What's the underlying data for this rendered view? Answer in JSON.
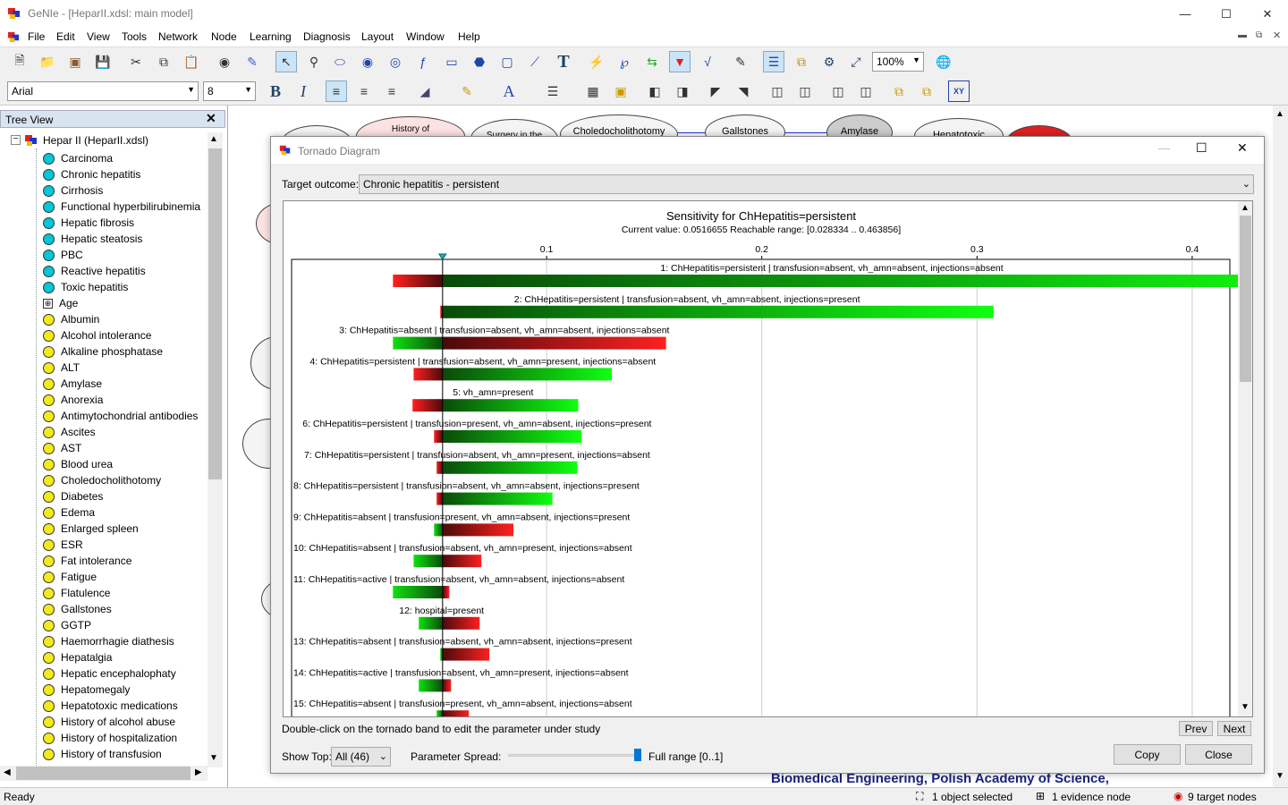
{
  "window": {
    "title": "GeNIe - [HeparII.xdsl: main model]"
  },
  "menu": [
    "File",
    "Edit",
    "View",
    "Tools",
    "Network",
    "Node",
    "Learning",
    "Diagnosis",
    "Layout",
    "Window",
    "Help"
  ],
  "toolbar": {
    "zoom": "100%",
    "font": "Arial",
    "font_size": "8"
  },
  "tree": {
    "header": "Tree View",
    "root": "Hepar II (HeparII.xdsl)",
    "items": [
      {
        "label": "Carcinoma",
        "kind": "target"
      },
      {
        "label": "Chronic hepatitis",
        "kind": "target"
      },
      {
        "label": "Cirrhosis",
        "kind": "target"
      },
      {
        "label": "Functional hyperbilirubinemia",
        "kind": "target"
      },
      {
        "label": "Hepatic fibrosis",
        "kind": "target"
      },
      {
        "label": "Hepatic steatosis",
        "kind": "target"
      },
      {
        "label": "PBC",
        "kind": "target"
      },
      {
        "label": "Reactive hepatitis",
        "kind": "target"
      },
      {
        "label": "Toxic hepatitis",
        "kind": "target"
      },
      {
        "label": "Age",
        "kind": "evidence"
      },
      {
        "label": "Albumin",
        "kind": "node"
      },
      {
        "label": "Alcohol intolerance",
        "kind": "node"
      },
      {
        "label": "Alkaline phosphatase",
        "kind": "node"
      },
      {
        "label": "ALT",
        "kind": "node"
      },
      {
        "label": "Amylase",
        "kind": "node"
      },
      {
        "label": "Anorexia",
        "kind": "node"
      },
      {
        "label": "Antimytochondrial antibodies",
        "kind": "node"
      },
      {
        "label": "Ascites",
        "kind": "node"
      },
      {
        "label": "AST",
        "kind": "node"
      },
      {
        "label": "Blood urea",
        "kind": "node"
      },
      {
        "label": "Choledocholithotomy",
        "kind": "node"
      },
      {
        "label": "Diabetes",
        "kind": "node"
      },
      {
        "label": "Edema",
        "kind": "node"
      },
      {
        "label": "Enlarged spleen",
        "kind": "node"
      },
      {
        "label": "ESR",
        "kind": "node"
      },
      {
        "label": "Fat intolerance",
        "kind": "node"
      },
      {
        "label": "Fatigue",
        "kind": "node"
      },
      {
        "label": "Flatulence",
        "kind": "node"
      },
      {
        "label": "Gallstones",
        "kind": "node"
      },
      {
        "label": "GGTP",
        "kind": "node"
      },
      {
        "label": "Haemorrhagie diathesis",
        "kind": "node"
      },
      {
        "label": "Hepatalgia",
        "kind": "node"
      },
      {
        "label": "Hepatic encephalophaty",
        "kind": "node"
      },
      {
        "label": "Hepatomegaly",
        "kind": "node"
      },
      {
        "label": "Hepatotoxic medications",
        "kind": "node"
      },
      {
        "label": "History of alcohol abuse",
        "kind": "node"
      },
      {
        "label": "History of hospitalization",
        "kind": "node"
      },
      {
        "label": "History of transfusion",
        "kind": "node"
      }
    ],
    "colors": {
      "target": "#00c8d8",
      "node": "#f2ea1a",
      "evidence": "#ffffff"
    }
  },
  "canvas": {
    "nodes": [
      "History of",
      "Surgery in the",
      "Choledocholithotomy",
      "Gallstones",
      "Amylase",
      "Hepatotoxic"
    ],
    "footer": "Biomedical Engineering, Polish Academy of Science,"
  },
  "dialog": {
    "title": "Tornado Diagram",
    "target_label": "Target outcome:",
    "target_value": "Chronic hepatitis - persistent",
    "hint": "Double-click on the tornado band to edit the parameter under study",
    "prev": "Prev",
    "next": "Next",
    "show_top_label": "Show Top:",
    "show_top_value": "All (46)",
    "spread_label": "Parameter Spread:",
    "spread_value": "Full range [0..1]",
    "spread_level": 1.0,
    "copy": "Copy",
    "close": "Close"
  },
  "chart_data": {
    "type": "bar",
    "orientation": "horizontal-tornado",
    "title": "Sensitivity for ChHepatitis=persistent",
    "subtitle": "Current value: 0.0516655  Reachable range: [0.028334 .. 0.463856]",
    "current_value": 0.0516655,
    "xlim": [
      -0.0185,
      0.4175
    ],
    "xticks": [
      "0.1",
      "0.2",
      "0.3",
      "0.4"
    ],
    "bars": [
      {
        "label": "1: ChHepatitis=persistent | transfusion=absent, vh_amn=absent, injections=absent",
        "low": 0.0286,
        "high": 0.4634,
        "low_side": "red"
      },
      {
        "label": "2: ChHepatitis=persistent | transfusion=absent, vh_amn=absent, injections=present",
        "low": 0.0506,
        "high": 0.3077,
        "low_side": "red"
      },
      {
        "label": "3: ChHepatitis=absent | transfusion=absent, vh_amn=absent, injections=absent",
        "low": 0.0286,
        "high": 0.1555,
        "low_side": "green"
      },
      {
        "label": "4: ChHepatitis=persistent | transfusion=absent, vh_amn=present, injections=absent",
        "low": 0.0382,
        "high": 0.1303,
        "low_side": "red"
      },
      {
        "label": "5: vh_amn=present",
        "low": 0.0377,
        "high": 0.1147,
        "low_side": "red"
      },
      {
        "label": "6: ChHepatitis=persistent | transfusion=present, vh_amn=absent, injections=present",
        "low": 0.0477,
        "high": 0.1163,
        "low_side": "red"
      },
      {
        "label": "7: ChHepatitis=persistent | transfusion=absent, vh_amn=present, injections=absent",
        "low": 0.0489,
        "high": 0.1143,
        "low_side": "red"
      },
      {
        "label": "8: ChHepatitis=persistent | transfusion=absent, vh_amn=absent, injections=present",
        "low": 0.0489,
        "high": 0.1027,
        "low_side": "red"
      },
      {
        "label": "9: ChHepatitis=absent | transfusion=present, vh_amn=absent, injections=present",
        "low": 0.0477,
        "high": 0.0846,
        "low_side": "green"
      },
      {
        "label": "10: ChHepatitis=absent | transfusion=absent, vh_amn=present, injections=absent",
        "low": 0.0382,
        "high": 0.0697,
        "low_side": "green"
      },
      {
        "label": "11: ChHepatitis=active | transfusion=absent, vh_amn=absent, injections=absent",
        "low": 0.0286,
        "high": 0.0548,
        "low_side": "green"
      },
      {
        "label": "12: hospital=present",
        "low": 0.0406,
        "high": 0.0689,
        "low_side": "green"
      },
      {
        "label": "13: ChHepatitis=absent | transfusion=absent, vh_amn=absent, injections=present",
        "low": 0.0506,
        "high": 0.0734,
        "low_side": "green"
      },
      {
        "label": "14: ChHepatitis=active | transfusion=absent, vh_amn=present, injections=absent",
        "low": 0.0406,
        "high": 0.0556,
        "low_side": "green"
      },
      {
        "label": "15: ChHepatitis=absent | transfusion=present, vh_amn=absent, injections=absent",
        "low": 0.0489,
        "high": 0.0639,
        "low_side": "green"
      }
    ]
  },
  "status": {
    "ready": "Ready",
    "selected": "1 object selected",
    "evidence": "1 evidence node",
    "targets": "9 target nodes"
  }
}
